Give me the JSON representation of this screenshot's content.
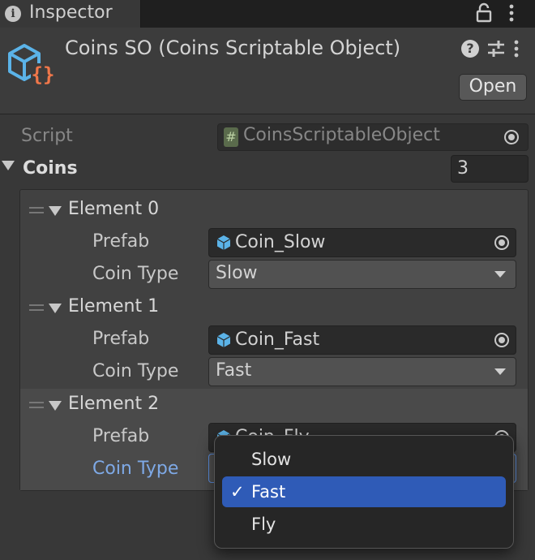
{
  "tab": {
    "title": "Inspector"
  },
  "header": {
    "asset_title": "Coins SO (Coins Scriptable Object)",
    "open_label": "Open"
  },
  "script": {
    "label": "Script",
    "value": "CoinsScriptableObject"
  },
  "coins": {
    "label": "Coins",
    "size": "3",
    "prefab_label": "Prefab",
    "coin_type_label": "Coin Type",
    "elements": [
      {
        "label": "Element 0",
        "prefab": "Coin_Slow",
        "coin_type": "Slow"
      },
      {
        "label": "Element 1",
        "prefab": "Coin_Fast",
        "coin_type": "Fast"
      },
      {
        "label": "Element 2",
        "prefab": "Coin_Fly",
        "coin_type": "Fast"
      }
    ]
  },
  "popup": {
    "items": [
      {
        "label": "Slow",
        "selected": false
      },
      {
        "label": "Fast",
        "selected": true
      },
      {
        "label": "Fly",
        "selected": false
      }
    ],
    "check_glyph": "✓"
  },
  "colors": {
    "accent": "#2f5bb7",
    "focus": "#7ea9e6",
    "script_icon": "#5a6b4c",
    "prefab_icon": "#5bb3e8",
    "asset_icon_outline": "#5bb3e8",
    "asset_icon_braces": "#f0774a"
  }
}
